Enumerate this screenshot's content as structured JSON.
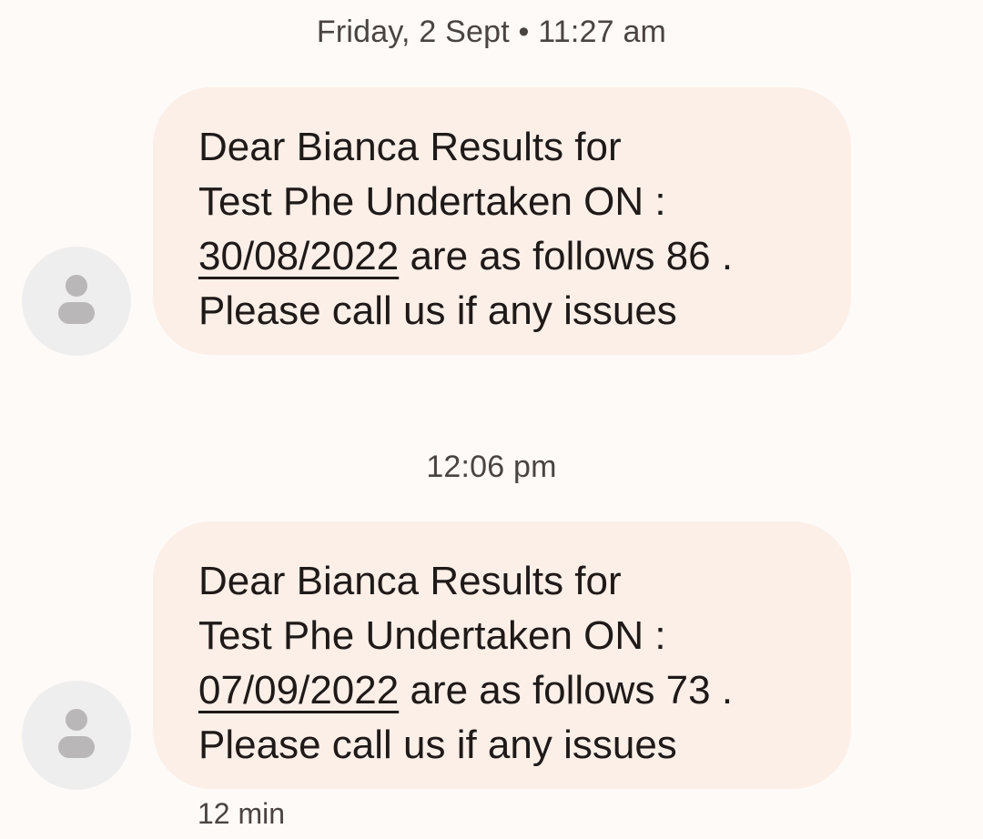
{
  "messages": [
    {
      "timestamp": "Friday, 2 Sept • 11:27 am",
      "line1": "Dear Bianca Results for",
      "line2": "Test Phe Undertaken ON :",
      "date": "30/08/2022",
      "line3_rest": " are as follows 86 .",
      "line4": "Please call us if any issues"
    },
    {
      "timestamp": "12:06 pm",
      "line1": "Dear Bianca Results for",
      "line2": "Test Phe Undertaken ON :",
      "date": "07/09/2022",
      "line3_rest": " are as follows 73 .",
      "line4": "Please call us if any issues",
      "meta": "12 min"
    }
  ],
  "icons": {
    "avatar": "person-placeholder-icon"
  },
  "colors": {
    "background": "#fefaf8",
    "bubble": "#fbefe8",
    "avatar_bg": "#efeeee",
    "avatar_fg": "#b9b7b7",
    "text": "#1f1a18",
    "secondary_text": "#4a4441"
  }
}
